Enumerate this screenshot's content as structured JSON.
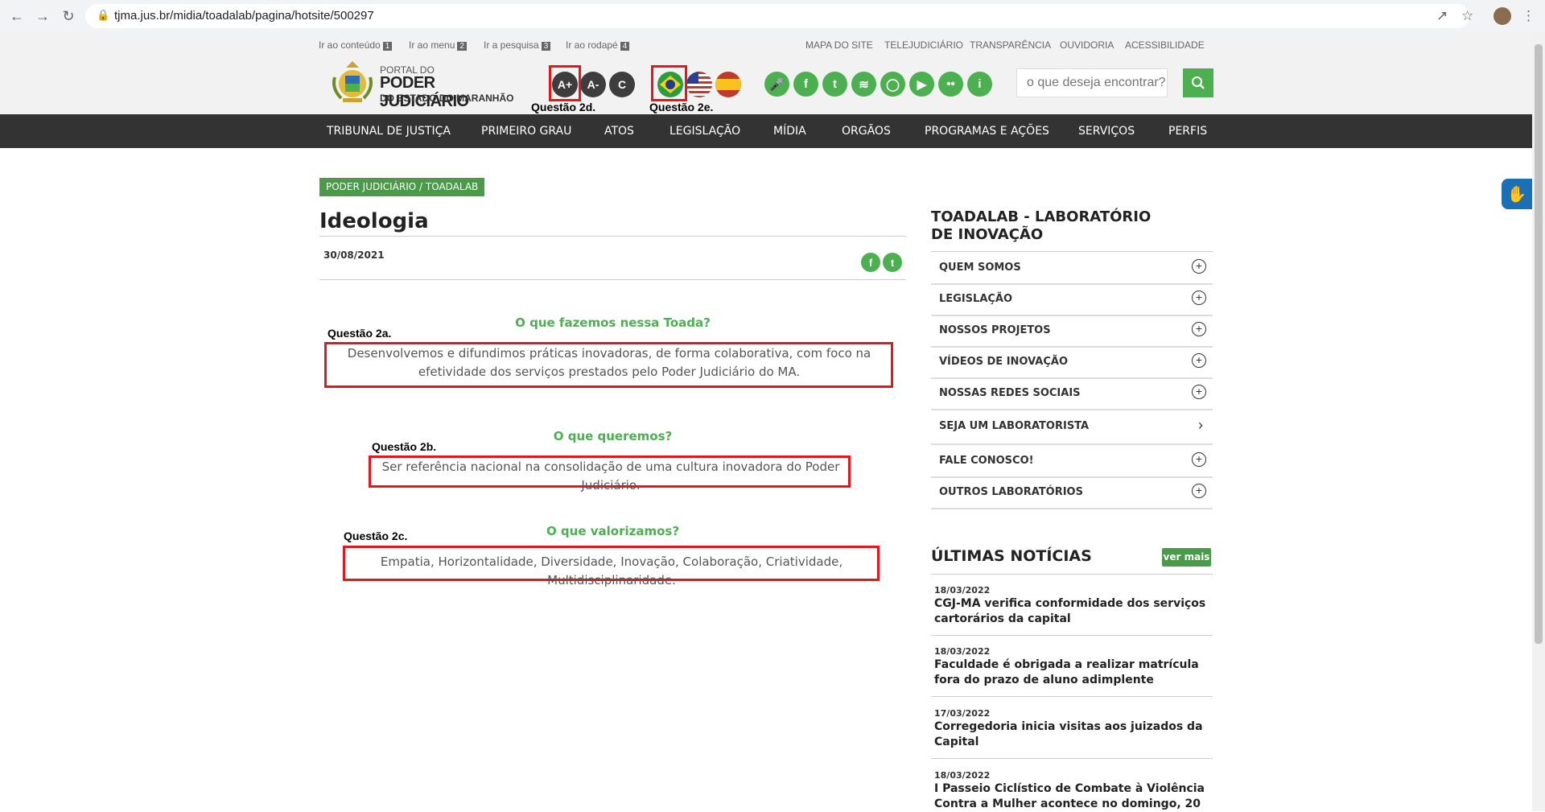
{
  "browser": {
    "url": "tjma.jus.br/midia/toadalab/pagina/hotsite/500297"
  },
  "header": {
    "skip_links": [
      {
        "label": "Ir ao conteúdo",
        "key": "1"
      },
      {
        "label": "Ir ao menu",
        "key": "2"
      },
      {
        "label": "Ir a pesquisa",
        "key": "3"
      },
      {
        "label": "Ir ao rodapé",
        "key": "4"
      }
    ],
    "top_links": [
      "MAPA DO SITE",
      "TELEJUDICIÁRIO",
      "TRANSPARÊNCIA",
      "OUVIDORIA",
      "ACESSIBILIDADE"
    ],
    "logo": {
      "line1": "PORTAL DO",
      "line2": "PODER JUDICIÁRIO",
      "line3": "DO ESTADO DO MARANHÃO"
    },
    "font_buttons": [
      "A+",
      "A-",
      "C"
    ],
    "search_placeholder": "o que deseja encontrar?",
    "social_icons": [
      "microphone-icon",
      "facebook-icon",
      "twitter-icon",
      "rss-icon",
      "instagram-icon",
      "youtube-icon",
      "flickr-icon",
      "info-icon"
    ]
  },
  "annotations": {
    "q2a": "Questão 2a.",
    "q2b": "Questão 2b.",
    "q2c": "Questão 2c.",
    "q2d": "Questão 2d.",
    "q2e": "Questão 2e."
  },
  "nav": [
    "TRIBUNAL DE JUSTIÇA",
    "PRIMEIRO GRAU",
    "ATOS",
    "LEGISLAÇÃO",
    "MÍDIA",
    "ORGÃOS",
    "PROGRAMAS E AÇÕES",
    "SERVIÇOS",
    "PERFIS"
  ],
  "content": {
    "breadcrumb": "PODER JUDICIÁRIO / TOADALAB",
    "title": "Ideologia",
    "date": "30/08/2021",
    "sections": [
      {
        "heading": "O que fazemos nessa Toada?",
        "text": "Desenvolvemos e difundimos práticas inovadoras, de forma colaborativa, com foco na efetividade dos serviços prestados pelo Poder Judiciário do MA."
      },
      {
        "heading": "O que queremos?",
        "text": "Ser referência  nacional na consolidação  de uma cultura inovadora do Poder Judiciário."
      },
      {
        "heading": "O que valorizamos?",
        "text": "Empatia, Horizontalidade, Diversidade, Inovação, Colaboração, Criatividade, Multidisciplinaridade."
      }
    ]
  },
  "sidebar": {
    "title": "TOADALAB - LABORATÓRIO DE INOVAÇÃO",
    "items": [
      "QUEM SOMOS",
      "LEGISLAÇÃO",
      "NOSSOS PROJETOS",
      "VÍDEOS DE INOVAÇÃO",
      "NOSSAS REDES SOCIAIS",
      "SEJA UM LABORATORISTA",
      "FALE CONOSCO!",
      "OUTROS LABORATÓRIOS"
    ],
    "news_title": "ÚLTIMAS NOTÍCIAS",
    "ver_mais": "ver mais",
    "news": [
      {
        "date": "18/03/2022",
        "text": "CGJ-MA verifica conformidade dos serviços cartorários da capital"
      },
      {
        "date": "18/03/2022",
        "text": "Faculdade é obrigada a realizar matrícula fora do prazo de aluno adimplente"
      },
      {
        "date": "17/03/2022",
        "text": "Corregedoria inicia visitas aos juizados da Capital"
      },
      {
        "date": "18/03/2022",
        "text": "I Passeio Ciclístico de Combate à Violência Contra a Mulher acontece no domingo, 20"
      }
    ]
  },
  "colors": {
    "accent": "#4caf50",
    "nav_bg": "#333333",
    "highlight": "#e3161b"
  }
}
